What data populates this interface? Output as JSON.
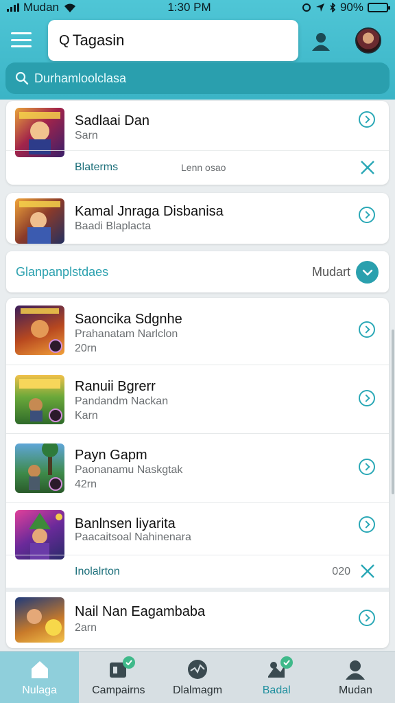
{
  "status_bar": {
    "carrier": "Mudan",
    "time": "1:30 PM",
    "battery": "90%"
  },
  "header": {
    "search_value": "Tagasin",
    "sub_search_placeholder": "Durhamloolclasa"
  },
  "cards": [
    {
      "title": "Sadlaai Dan",
      "subtitle": "Sarn",
      "footer_label": "Blaterms",
      "footer_meta": "Lenn osao"
    },
    {
      "title": "Kamal Jnraga Disbanisa",
      "subtitle": "Baadi Blaplacta"
    }
  ],
  "section": {
    "title": "Glanpanplstdaes",
    "right_label": "Mudart"
  },
  "list": [
    {
      "title": "Saoncika Sdgnhe",
      "subtitle": "Prahanatam Narlclon",
      "meta": "20rn"
    },
    {
      "title": "Ranuii Bgrerr",
      "subtitle": "Pandandm Nackan",
      "meta": "Karn"
    },
    {
      "title": "Payn Gapm",
      "subtitle": "Paonanamu Naskgtak",
      "meta": "42rn"
    },
    {
      "title": "Banlnsen liyarita",
      "subtitle": "Paacaitsoal Nahinenara",
      "footer_label": "Inolalrton",
      "footer_meta": "020"
    },
    {
      "title": "Nail Nan Eagambaba",
      "subtitle": "2arn"
    }
  ],
  "bottom_nav": [
    {
      "label": "Nulaga",
      "icon": "home-icon"
    },
    {
      "label": "Campairns",
      "icon": "campaign-icon"
    },
    {
      "label": "Dlalmagm",
      "icon": "stats-icon"
    },
    {
      "label": "Badal",
      "icon": "badge-icon"
    },
    {
      "label": "Mudan",
      "icon": "profile-icon"
    }
  ],
  "colors": {
    "accent": "#2aa0ae",
    "header": "#4fc6d6",
    "nav_active": "#8fcfdb"
  }
}
